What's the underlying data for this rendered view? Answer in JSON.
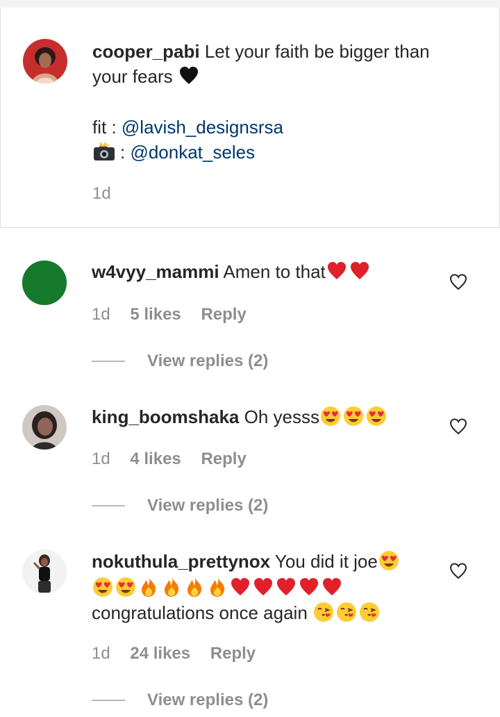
{
  "caption": {
    "username": "cooper_pabi",
    "text_line1": "Let your faith be bigger than",
    "text_line2": "your fears",
    "fit_label": "fit : ",
    "fit_handle": "@lavish_designsrsa",
    "photo_label": ": ",
    "photo_handle": "@donkat_seles",
    "time": "1d",
    "avatar_icon": "profile-photo-icon",
    "heart_emoji": "black-heart-emoji",
    "camera_emoji": "camera-with-flash-emoji"
  },
  "comments": [
    {
      "username": "w4vyy_mammi",
      "text": "Amen to that",
      "emojis": [
        "red-heart",
        "red-heart"
      ],
      "time": "1d",
      "likes": "5 likes",
      "reply": "Reply",
      "view_replies": "View replies (2)",
      "avatar_color": "#157a2b"
    },
    {
      "username": "king_boomshaka",
      "text": "Oh yesss",
      "emojis": [
        "heart-eyes",
        "heart-eyes",
        "heart-eyes"
      ],
      "time": "1d",
      "likes": "4 likes",
      "reply": "Reply",
      "view_replies": "View replies (2)",
      "avatar_icon": "profile-photo-icon"
    },
    {
      "username": "nokuthula_prettynox",
      "text_line1": "You did it joe",
      "line1_emojis": [
        "heart-eyes"
      ],
      "line2_emojis": [
        "heart-eyes",
        "heart-eyes",
        "fire",
        "fire",
        "fire",
        "fire",
        "red-heart",
        "red-heart",
        "red-heart",
        "red-heart",
        "red-heart"
      ],
      "text_line3": "congratulations once again ",
      "line3_emojis": [
        "kissing-heart",
        "kissing-heart",
        "kissing-heart"
      ],
      "time": "1d",
      "likes": "24 likes",
      "reply": "Reply",
      "view_replies": "View replies (2)",
      "avatar_icon": "profile-photo-icon"
    }
  ],
  "colors": {
    "username": "#262626",
    "mention": "#00376b",
    "meta": "#8e8e8e",
    "heart_red": "#e0202b"
  },
  "icons": {
    "like": "heart-outline-icon"
  }
}
